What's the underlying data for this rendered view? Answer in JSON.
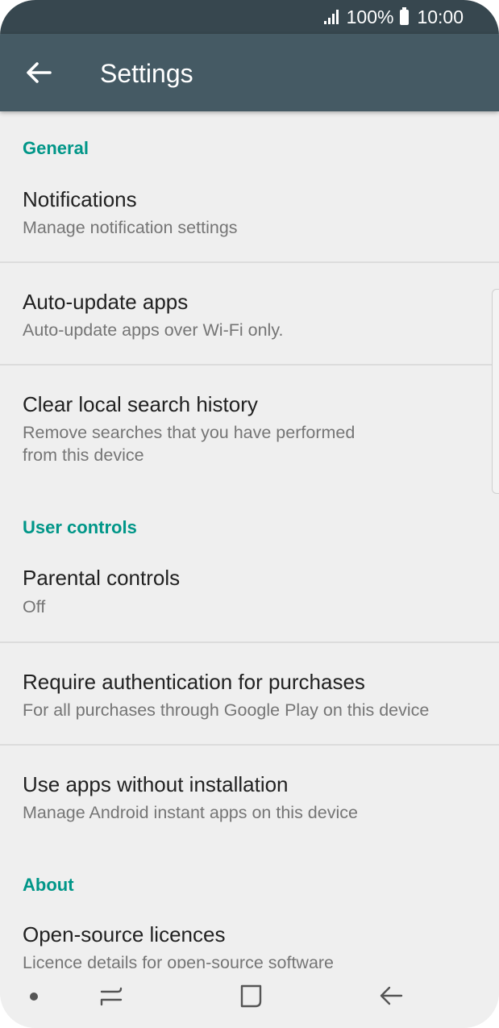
{
  "status_bar": {
    "battery_text": "100%",
    "time": "10:00",
    "icons": [
      "signal-icon",
      "battery-icon"
    ]
  },
  "app_bar": {
    "title": "Settings",
    "back_icon": "back-arrow-icon"
  },
  "sections": [
    {
      "header": "General",
      "items": [
        {
          "title": "Notifications",
          "subtitle": "Manage notification settings"
        },
        {
          "title": "Auto-update apps",
          "subtitle": "Auto-update apps over Wi-Fi only."
        },
        {
          "title": "Clear local search history",
          "subtitle": "Remove searches that you have performed\nfrom this device"
        }
      ]
    },
    {
      "header": "User controls",
      "items": [
        {
          "title": "Parental controls",
          "subtitle": "Off"
        },
        {
          "title": "Require authentication for purchases",
          "subtitle": "For all purchases through Google Play on this device"
        },
        {
          "title": "Use apps without installation",
          "subtitle": "Manage Android instant apps on this device"
        }
      ]
    },
    {
      "header": "About",
      "items": [
        {
          "title": "Open-source licences",
          "subtitle": "Licence details for open-source software"
        }
      ]
    }
  ],
  "nav_bar": {
    "icons": [
      "dot-icon",
      "recents-icon",
      "home-icon",
      "back-icon"
    ]
  },
  "colors": {
    "status_bar": "#37474f",
    "app_bar": "#455a64",
    "accent": "#009688",
    "background": "#efefef"
  }
}
